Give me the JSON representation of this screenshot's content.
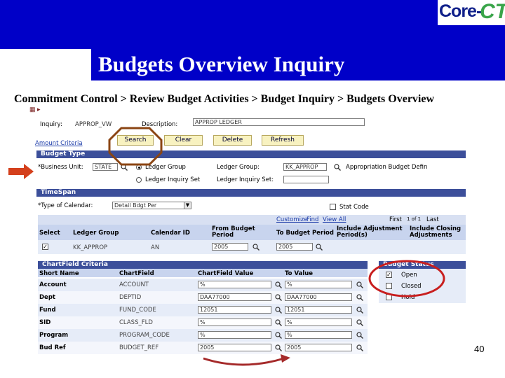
{
  "slide": {
    "title": "Budgets Overview Inquiry",
    "breadcrumb": "Commitment Control > Review Budget Activities > Budget Inquiry > Budgets Overview",
    "page_number": "40",
    "logo": {
      "core": "Core-",
      "ct": "CT"
    }
  },
  "app": {
    "inquiry_label": "Inquiry:",
    "inquiry_value": "APPROP_VW",
    "description_label": "Description:",
    "description_value": "APPROP LEDGER",
    "buttons": {
      "search": "Search",
      "clear": "Clear",
      "delete": "Delete",
      "refresh": "Refresh"
    },
    "amount_criteria_link": "Amount Criteria",
    "budget_type": {
      "header": "Budget Type",
      "business_unit_label": "*Business Unit:",
      "business_unit_value": "STATE",
      "ledger_group_radio": "Ledger Group",
      "ledger_inquiry_set_radio": "Ledger Inquiry Set",
      "ledger_group_label": "Ledger Group:",
      "ledger_group_value": "KK_APPROP",
      "ledger_group_desc": "Appropriation Budget Defin",
      "ledger_inquiry_set_label": "Ledger Inquiry Set:",
      "ledger_inquiry_set_value": ""
    },
    "timespan": {
      "header": "TimeSpan",
      "type_of_calendar_label": "*Type of Calendar:",
      "type_of_calendar_value": "Detail Bdgt Per",
      "stat_code_label": "Stat Code",
      "customize": "Customize",
      "find": "Find",
      "view_all": "View All",
      "first": "First",
      "pager": "1 of 1",
      "last": "Last",
      "columns": [
        "Select",
        "Ledger Group",
        "Calendar ID",
        "From Budget Period",
        "To Budget Period",
        "Include Adjustment Period(s)",
        "Include Closing Adjustments"
      ],
      "row": {
        "ledger_group": "KK_APPROP",
        "calendar_id": "AN",
        "from_period": "2005",
        "to_period": "2005"
      }
    },
    "chartfield": {
      "header": "ChartField Criteria",
      "columns": [
        "Short Name",
        "ChartField",
        "ChartField Value",
        "To Value"
      ],
      "rows": [
        {
          "short": "Account",
          "field": "ACCOUNT",
          "value": "%",
          "to": "%"
        },
        {
          "short": "Dept",
          "field": "DEPTID",
          "value": "DAA77000",
          "to": "DAA77000"
        },
        {
          "short": "Fund",
          "field": "FUND_CODE",
          "value": "12051",
          "to": "12051"
        },
        {
          "short": "SID",
          "field": "CLASS_FLD",
          "value": "%",
          "to": "%"
        },
        {
          "short": "Program",
          "field": "PROGRAM_CODE",
          "value": "%",
          "to": "%"
        },
        {
          "short": "Bud Ref",
          "field": "BUDGET_REF",
          "value": "2005",
          "to": "2005"
        }
      ]
    },
    "budget_status": {
      "header": "Budget Status",
      "items": [
        "Open",
        "Closed",
        "Hold"
      ]
    }
  }
}
